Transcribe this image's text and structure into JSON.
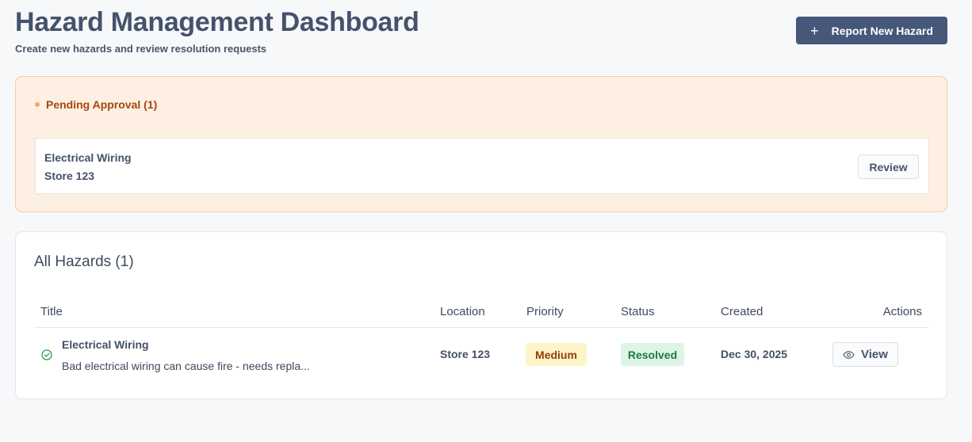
{
  "header": {
    "title": "Hazard Management Dashboard",
    "subtitle": "Create new hazards and review resolution requests",
    "report_button_label": "Report New Hazard"
  },
  "pending": {
    "heading": "Pending Approval (1)",
    "items": [
      {
        "title": "Electrical Wiring",
        "location": "Store 123",
        "action_label": "Review"
      }
    ]
  },
  "all_hazards": {
    "heading": "All Hazards (1)",
    "columns": [
      "Title",
      "Location",
      "Priority",
      "Status",
      "Created",
      "Actions"
    ],
    "rows": [
      {
        "title": "Electrical Wiring",
        "description": "Bad electrical wiring can cause fire - needs repla...",
        "location": "Store 123",
        "priority": "Medium",
        "status": "Resolved",
        "created": "Dec 30, 2025",
        "action_label": "View",
        "status_icon": "check-circle-icon"
      }
    ]
  },
  "colors": {
    "primary_button": "#46577a",
    "pending_bg": "#fdf0e3",
    "pending_border": "#f4cfa2",
    "pending_text": "#a5470c",
    "priority_medium_bg": "#fdf4c8",
    "status_resolved_bg": "#dcf5e6",
    "status_resolved_text": "#1f7a3c"
  }
}
